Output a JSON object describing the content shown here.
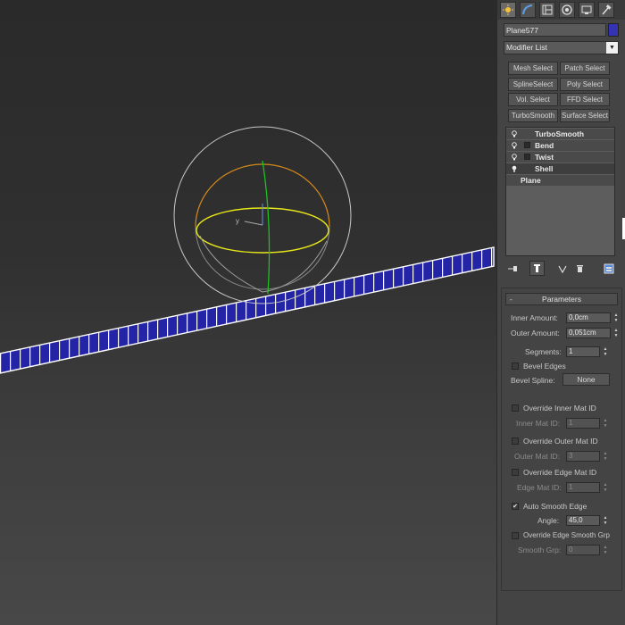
{
  "command_panel": {
    "tabs": [
      {
        "name": "create-tab",
        "icon": "sun-icon"
      },
      {
        "name": "modify-tab",
        "icon": "modify-curve-icon"
      },
      {
        "name": "hierarchy-tab",
        "icon": "hierarchy-icon"
      },
      {
        "name": "motion-tab",
        "icon": "motion-icon"
      },
      {
        "name": "display-tab",
        "icon": "display-monitor-icon"
      },
      {
        "name": "utilities-tab",
        "icon": "hammer-icon"
      }
    ],
    "object_name": "Plane577",
    "object_color": "#3333b4",
    "modifier_list_label": "Modifier List",
    "modifier_buttons": [
      "Mesh Select",
      "Patch Select",
      "SplineSelect",
      "Poly Select",
      "Vol. Select",
      "FFD Select",
      "TurboSmooth",
      "Surface Select"
    ],
    "stack": [
      {
        "label": "TurboSmooth",
        "has_bulb": true,
        "has_box": false
      },
      {
        "label": "Bend",
        "has_bulb": true,
        "has_box": true
      },
      {
        "label": "Twist",
        "has_bulb": true,
        "has_box": true
      },
      {
        "label": "Shell",
        "has_bulb": true,
        "has_box": false
      },
      {
        "label": "Plane",
        "has_bulb": false,
        "has_box": false
      }
    ]
  },
  "parameters": {
    "title": "Parameters",
    "inner_amount_label": "Inner Amount:",
    "inner_amount": "0,0cm",
    "outer_amount_label": "Outer Amount:",
    "outer_amount": "0,051cm",
    "segments_label": "Segments:",
    "segments": "1",
    "bevel_edges_label": "Bevel Edges",
    "bevel_spline_label": "Bevel Spline:",
    "bevel_spline_value": "None",
    "override_inner_label": "Override Inner Mat ID",
    "inner_mat_label": "Inner Mat ID:",
    "inner_mat": "1",
    "override_outer_label": "Override Outer Mat ID",
    "outer_mat_label": "Outer Mat ID:",
    "outer_mat": "3",
    "override_edge_label": "Override Edge Mat ID",
    "edge_mat_label": "Edge Mat ID:",
    "edge_mat": "1",
    "auto_smooth_label": "Auto Smooth Edge",
    "auto_smooth_checked": true,
    "angle_label": "Angle:",
    "angle": "45,0",
    "override_smooth_label": "Override Edge Smooth Grp",
    "smooth_grp_label": "Smooth Grp:",
    "smooth_grp": "0"
  },
  "viewport": {
    "gizmo_axis_label": "y"
  }
}
